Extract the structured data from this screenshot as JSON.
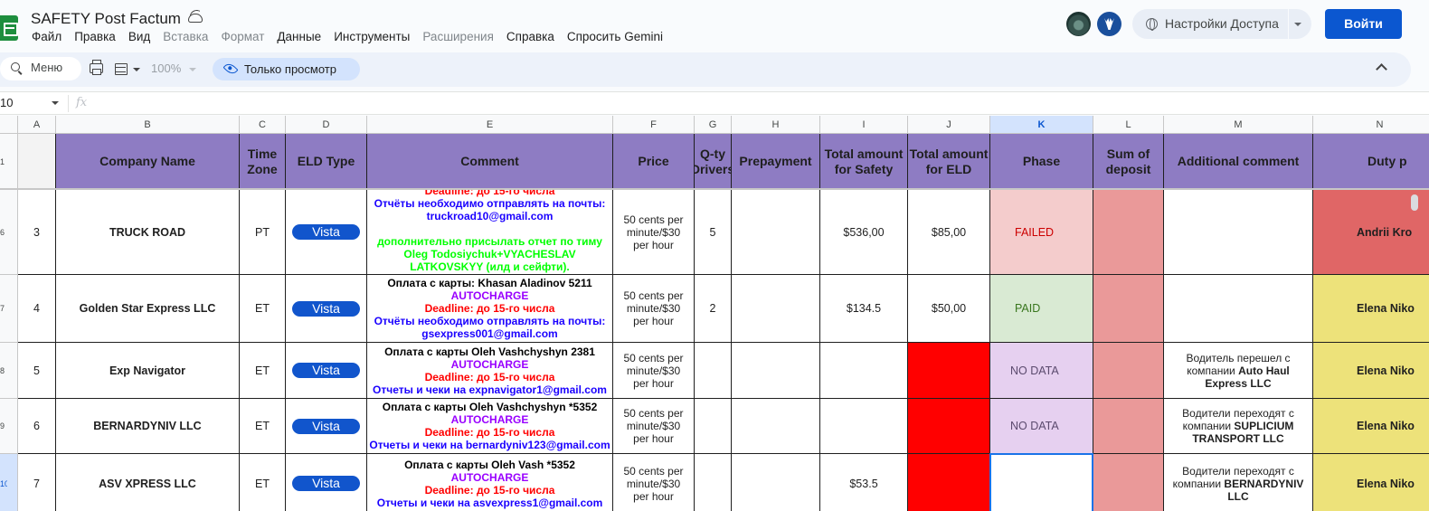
{
  "doc": {
    "title": "SAFETY Post Factum",
    "menu": [
      {
        "label": "Файл",
        "disabled": false
      },
      {
        "label": "Правка",
        "disabled": false
      },
      {
        "label": "Вид",
        "disabled": false
      },
      {
        "label": "Вставка",
        "disabled": true
      },
      {
        "label": "Формат",
        "disabled": true
      },
      {
        "label": "Данные",
        "disabled": false
      },
      {
        "label": "Инструменты",
        "disabled": false
      },
      {
        "label": "Расширения",
        "disabled": true
      },
      {
        "label": "Справка",
        "disabled": false
      },
      {
        "label": "Спросить Gemini",
        "disabled": false
      }
    ]
  },
  "header": {
    "share_label": "Настройки Доступа",
    "login_label": "Войти"
  },
  "toolbar": {
    "menu_search": "Меню",
    "zoom": "100%",
    "view_mode": "Только просмотр"
  },
  "formula_bar": {
    "namebox": "10",
    "fx": "fx"
  },
  "sheet": {
    "columns": [
      "A",
      "B",
      "C",
      "D",
      "E",
      "F",
      "G",
      "H",
      "I",
      "J",
      "K",
      "L",
      "M",
      "N"
    ],
    "selected_column": "K",
    "row_numbers": [
      "1",
      "6",
      "7",
      "8",
      "9",
      "10"
    ],
    "selected_row": "10",
    "headers": [
      "",
      "Company Name",
      "Time Zone",
      "ELD Type",
      "Comment",
      "Price",
      "Q-ty Drivers",
      "Prepayment",
      "Total amount for Safety",
      "Total amount for ELD",
      "Phase",
      "Sum of deposit",
      "Additional comment",
      "Duty p"
    ],
    "rows": [
      {
        "n": "3",
        "company": "TRUCK ROAD",
        "tz": "PT",
        "eld": "Vista",
        "comment": [
          {
            "t": "Deadline: до 15-го числа",
            "c": "red"
          },
          {
            "t": "Отчёты необходимо отправлять на почты: truckroad10@gmail.com",
            "c": "blue"
          },
          {
            "t": "",
            "c": "blue"
          },
          {
            "t": "дополнительно присылать отчет по тиму Oleg Todosiychuk+VYACHESLAV LATKOVSKYY (илд и сейфти).",
            "c": "green"
          }
        ],
        "price": "50 cents per minute/$30 per hour",
        "qty": "5",
        "prepayment": "",
        "safety": "$536,00",
        "eld_total": "$85,00",
        "phase": "FAILED",
        "deposit": "",
        "additional": [],
        "duty": "Andrii Kro"
      },
      {
        "n": "4",
        "company": "Golden Star Express LLC",
        "tz": "ET",
        "eld": "Vista",
        "comment": [
          {
            "t": "Оплата с карты: Khasan Aladinov 5211",
            "c": "black"
          },
          {
            "t": "AUTOCHARGE",
            "c": "purple"
          },
          {
            "t": "Deadline: до 15-го числа",
            "c": "red"
          },
          {
            "t": "Отчёты необходимо отправлять на почты: gsexpress001@gmail.com",
            "c": "blue"
          }
        ],
        "price": "50 cents per minute/$30 per hour",
        "qty": "2",
        "prepayment": "",
        "safety": "$134.5",
        "eld_total": "$50,00",
        "phase": "PAID",
        "deposit": "",
        "additional": [],
        "duty": "Elena Niko"
      },
      {
        "n": "5",
        "company": "Exp Navigator",
        "tz": "ET",
        "eld": "Vista",
        "comment": [
          {
            "t": "Оплата с карты Oleh Vashchyshyn 2381",
            "c": "black"
          },
          {
            "t": "AUTOCHARGE",
            "c": "purple"
          },
          {
            "t": "Deadline: до 15-го числа",
            "c": "red"
          },
          {
            "t": "Отчеты и чеки на expnavigator1@gmail.com",
            "c": "blue"
          }
        ],
        "price": "50 cents per minute/$30 per hour",
        "qty": "",
        "prepayment": "",
        "safety": "",
        "eld_total": "",
        "phase": "NO DATA",
        "deposit": "",
        "additional": [
          {
            "t": "Водитель перешел с компании ",
            "b": false
          },
          {
            "t": "Auto Haul Express LLC",
            "b": true
          }
        ],
        "duty": "Elena Niko"
      },
      {
        "n": "6",
        "company": "BERNARDYNIV LLC",
        "tz": "ET",
        "eld": "Vista",
        "comment": [
          {
            "t": "Оплата с карты Oleh Vashchyshyn *5352",
            "c": "black"
          },
          {
            "t": "AUTOCHARGE",
            "c": "purple"
          },
          {
            "t": "Deadline: до 15-го числа",
            "c": "red"
          },
          {
            "t": "Отчеты и чеки на bernardyniv123@gmail.com",
            "c": "blue"
          }
        ],
        "price": "50 cents per minute/$30 per hour",
        "qty": "",
        "prepayment": "",
        "safety": "",
        "eld_total": "",
        "phase": "NO DATA",
        "deposit": "",
        "additional": [
          {
            "t": "Водители переходят с компании ",
            "b": false
          },
          {
            "t": "SUPLICIUM TRANSPORT LLC",
            "b": true
          }
        ],
        "duty": "Elena Niko"
      },
      {
        "n": "7",
        "company": "ASV XPRESS LLC",
        "tz": "ET",
        "eld": "Vista",
        "comment": [
          {
            "t": "Оплата с карты Oleh Vash *5352",
            "c": "black"
          },
          {
            "t": "AUTOCHARGE",
            "c": "purple"
          },
          {
            "t": "Deadline: до 15-го числа",
            "c": "red"
          },
          {
            "t": "Отчеты и чеки на asvexpress1@gmail.com",
            "c": "blue"
          }
        ],
        "price": "50 cents per minute/$30 per hour",
        "qty": "",
        "prepayment": "",
        "safety": "$53.5",
        "eld_total": "",
        "phase": "",
        "deposit": "",
        "additional": [
          {
            "t": "Водители переходят с компании ",
            "b": false
          },
          {
            "t": "BERNARDYNIV LLC",
            "b": true
          }
        ],
        "duty": "Elena Niko"
      }
    ],
    "colors": {
      "header_bg": "#8e7cc3",
      "deposit_bg": "#ea9999",
      "failed_bg": "#f4cccc",
      "failed_text": "#cc0000",
      "paid_bg": "#d9ead3",
      "paid_text": "#38761d",
      "nodata_bg": "#e6d0f0",
      "nodata_text": "#5b4a6e",
      "eld_missing_bg": "#ff0000",
      "duty_red": "#e06666",
      "duty_yellow": "#ede27a",
      "vista_pill": "#1155cc"
    }
  }
}
